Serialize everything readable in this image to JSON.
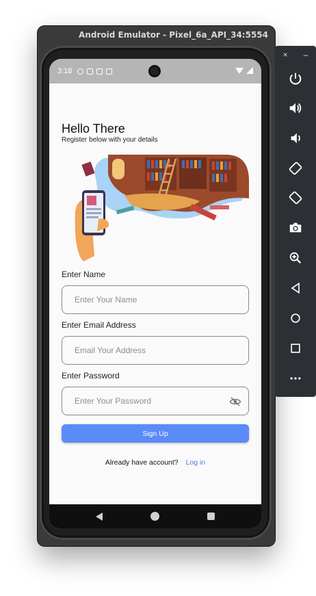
{
  "window": {
    "title": "Android Emulator - Pixel_6a_API_34:5554"
  },
  "status_bar": {
    "time": "3:18"
  },
  "app": {
    "heading": "Hello There",
    "subheading": "Register below with your details",
    "fields": [
      {
        "label": "Enter Name",
        "placeholder": "Enter Your Name"
      },
      {
        "label": "Enter Email Address",
        "placeholder": "Email Your Address"
      },
      {
        "label": "Enter Password",
        "placeholder": "Enter Your Password"
      }
    ],
    "signup_label": "Sign Up",
    "login_prompt": "Already have account?",
    "login_link": "Log in"
  },
  "toolbar": {
    "close": "×",
    "minimize": "–",
    "buttons": [
      "power-icon",
      "volume-up-icon",
      "volume-down-icon",
      "rotate-left-icon",
      "rotate-right-icon",
      "camera-icon",
      "zoom-icon",
      "back-icon",
      "home-icon",
      "overview-icon",
      "more-icon"
    ]
  },
  "colors": {
    "accent": "#5b8bf8",
    "link": "#4d7fe8",
    "toolbar_bg": "#2c2f33"
  }
}
